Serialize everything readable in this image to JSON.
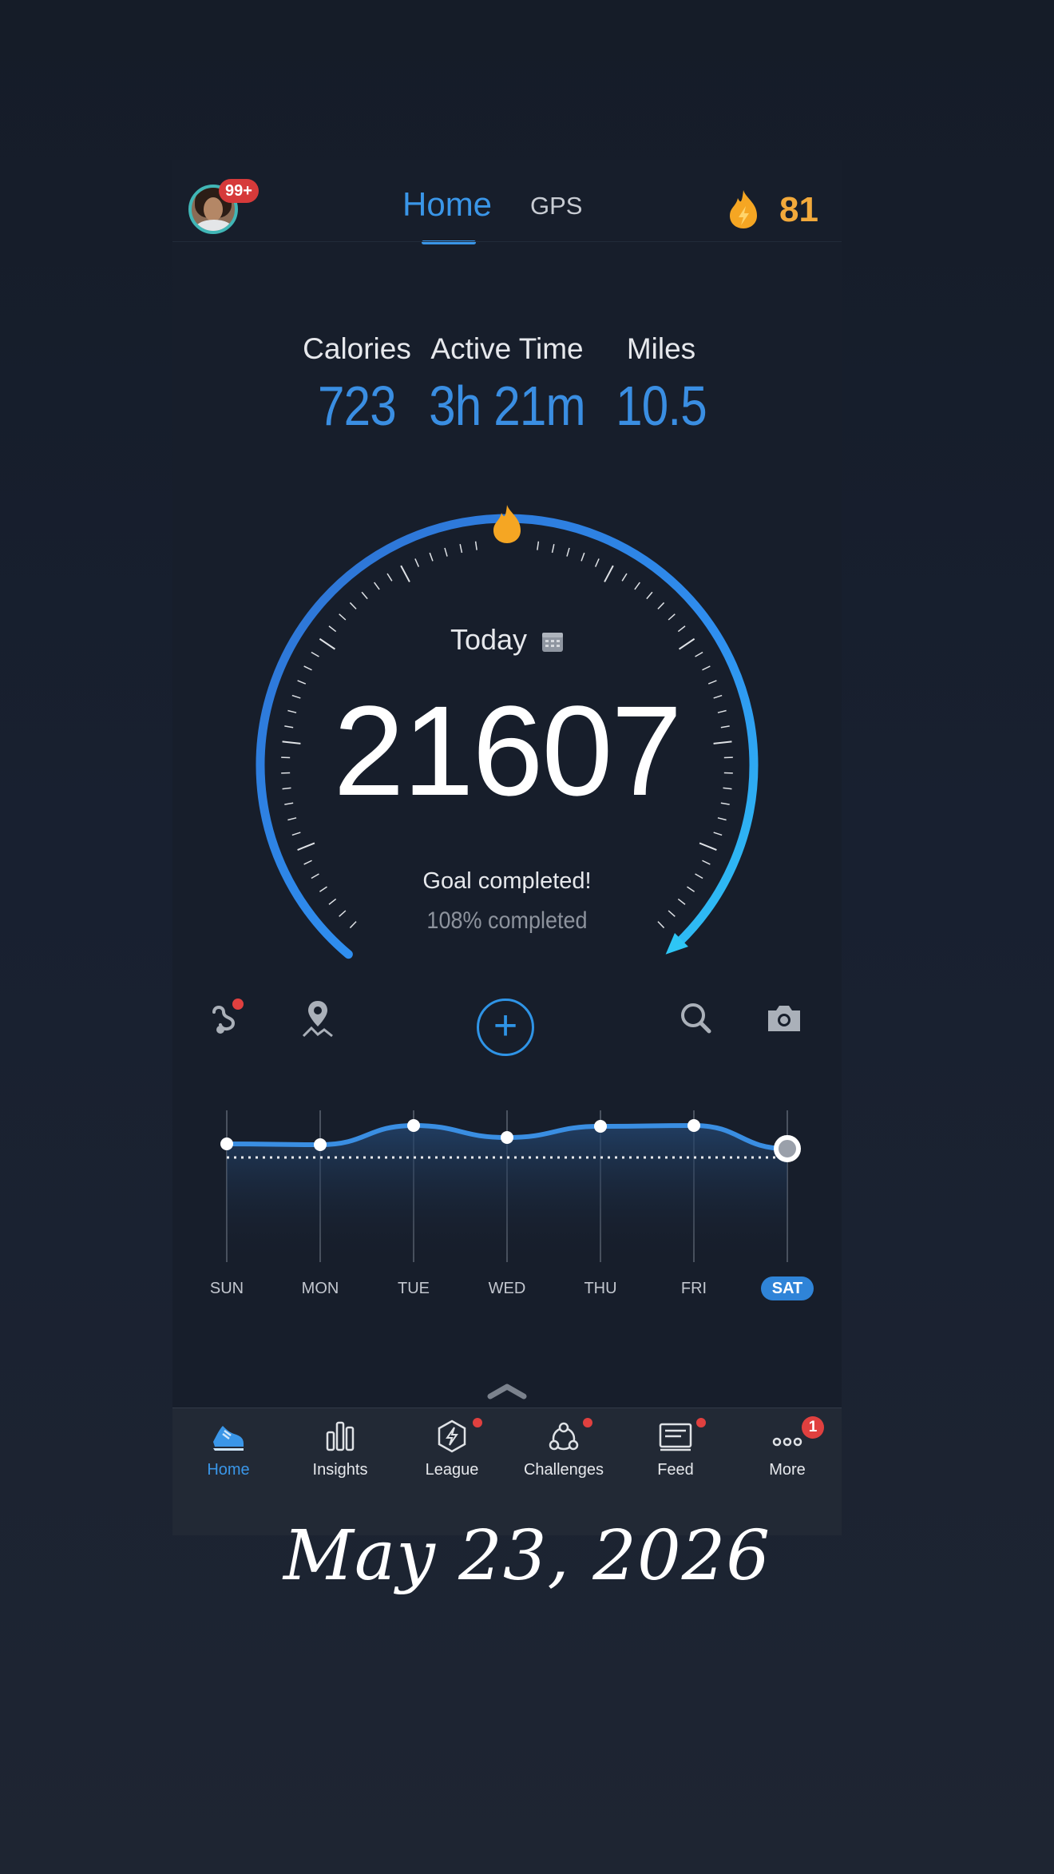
{
  "header": {
    "notifications_badge": "99+",
    "tabs": [
      {
        "label": "Home",
        "active": true
      },
      {
        "label": "GPS",
        "active": false
      }
    ],
    "streak_icon": "flame-bolt-icon",
    "streak_count": "81"
  },
  "stats": [
    {
      "label": "Calories",
      "value": "723"
    },
    {
      "label": "Active Time",
      "value": "3h 21m"
    },
    {
      "label": "Miles",
      "value": "10.5"
    }
  ],
  "gauge": {
    "period_label": "Today",
    "steps": "21607",
    "goal_text": "Goal completed!",
    "percent_text": "108% completed",
    "progress_percent": 108,
    "accent": "#2f94e6",
    "flame_color": "#f5a623"
  },
  "actions": {
    "left": [
      "route-icon",
      "map-pin-icon"
    ],
    "center": "add-icon",
    "right": [
      "search-icon",
      "camera-icon"
    ]
  },
  "week": {
    "days": [
      "SUN",
      "MON",
      "TUE",
      "WED",
      "THU",
      "FRI",
      "SAT"
    ],
    "selected": "SAT"
  },
  "nav": [
    {
      "label": "Home",
      "icon": "sneaker-icon",
      "active": true
    },
    {
      "label": "Insights",
      "icon": "bar-chart-icon"
    },
    {
      "label": "League",
      "icon": "hexagon-bolt-icon",
      "dot": true
    },
    {
      "label": "Challenges",
      "icon": "people-circle-icon",
      "dot": true
    },
    {
      "label": "Feed",
      "icon": "news-icon",
      "dot": true
    },
    {
      "label": "More",
      "icon": "more-dots-icon",
      "badge": "1"
    }
  ],
  "footer_date": "May 23, 2026"
}
